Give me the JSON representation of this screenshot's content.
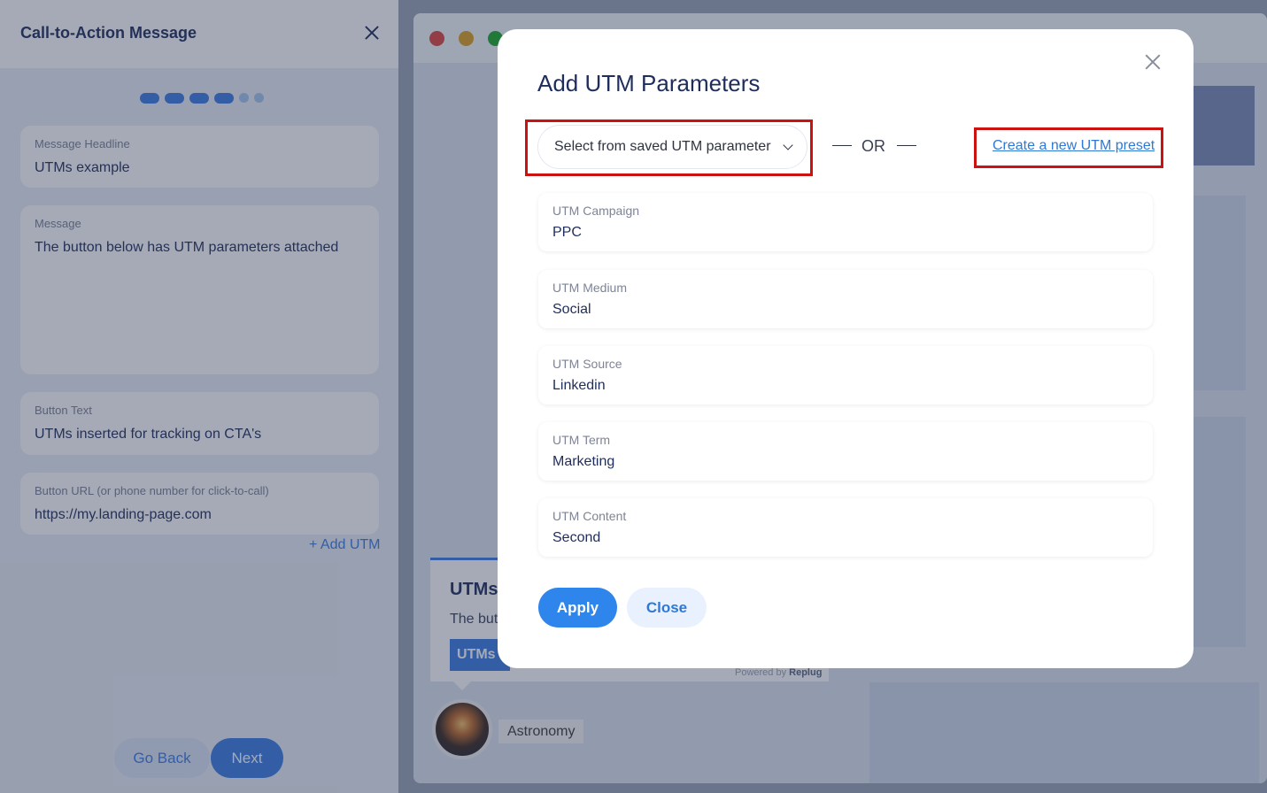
{
  "sidebar": {
    "title": "Call-to-Action Message",
    "fields": [
      {
        "label": "Message Headline",
        "value": "UTMs example"
      },
      {
        "label": "Message",
        "value": "The button below has UTM parameters attached"
      },
      {
        "label": "Button Text",
        "value": "UTMs inserted for tracking on CTA's"
      },
      {
        "label": "Button URL (or phone number for click-to-call)",
        "value": "https://my.landing-page.com"
      }
    ],
    "add_utm": "+ Add UTM",
    "back_label": "Go Back",
    "next_label": "Next"
  },
  "preview": {
    "cta_title": "UTMs",
    "cta_message": "The but",
    "cta_button": "UTMs i",
    "powered_prefix": "Powered by",
    "powered_brand": "Replug",
    "profile_name": "Astronomy"
  },
  "modal": {
    "title": "Add UTM Parameters",
    "select_placeholder": "Select from saved UTM parameter",
    "or_text": "OR",
    "create_link": "Create a new UTM preset",
    "fields": [
      {
        "label": "UTM Campaign",
        "value": "PPC"
      },
      {
        "label": "UTM Medium",
        "value": "Social"
      },
      {
        "label": "UTM Source",
        "value": "Linkedin"
      },
      {
        "label": "UTM Term",
        "value": "Marketing"
      },
      {
        "label": "UTM Content",
        "value": "Second"
      }
    ],
    "apply_label": "Apply",
    "close_label": "Close"
  },
  "colors": {
    "primary": "#2e85ec",
    "highlight": "#cc1111",
    "text_dark": "#1f2d5c"
  }
}
